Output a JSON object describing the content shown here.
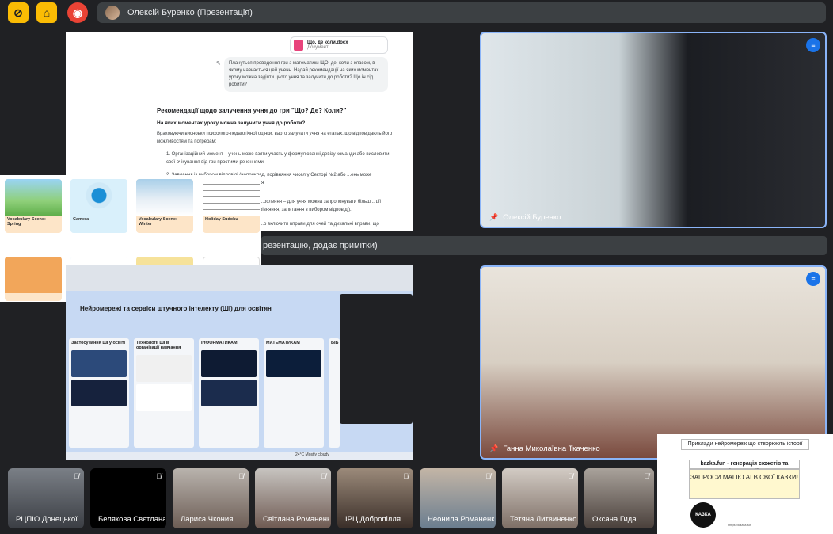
{
  "meeting": {
    "title": "Олексій Буренко (Презентація)",
    "caption": "резентацію, додає примітки)"
  },
  "colors": {
    "accent": "#8ab4f8",
    "speaking": "#1a73e8",
    "warning": "#fbbc04",
    "record": "#ea4335"
  },
  "toolbar": {
    "icons": [
      "no-captions-icon",
      "present-icon",
      "record-icon"
    ]
  },
  "doc": {
    "file_name": "Що, де коли.docx",
    "file_type": "Документ",
    "prompt": "Плануться проведення гри з математики ЩО, де, коли з класом, в якому навчається цей учень. Надай рекомендації на яких моментах уроку можна задіяти цього учня та залучити до роботи? Що ін сід робити?",
    "heading": "Рекомендації щодо залучення учня до гри \"Що? Де? Коли?\"",
    "subheading": "На яких моментах уроку можна залучити учня до роботи?",
    "p1": "Враховуючи висновки психолого-педагогічної оцінки, варто залучати учня на етапах, що відповідають його можливостям та потребам:",
    "p2a": "1. Організаційний момент – учень може взяти участь у формулюванні девізу команди або висловити свої очікування від гри простими реченнями.",
    "p2b": "2. Завдання із вибором відповіді (наприклад, порівняння чисел у Секторі №2 або ...ень може працювати із підтримкою асистента вчителя",
    "p3": "...ослення – для учня можна запропонувати більш ...ції рівняння, запитання з вибором відповіді).",
    "p4": "...о включити вправи для очей та дихальні вправи, що"
  },
  "apps": [
    {
      "label": "Vocabulary Scene: Spring"
    },
    {
      "label": "Camera"
    },
    {
      "label": "Vocabulary Scene: Winter"
    },
    {
      "label": "Holiday Sudoku"
    },
    {
      "label": ""
    },
    {
      "label": ""
    },
    {
      "label": ""
    },
    {
      "label": ""
    }
  ],
  "screen2": {
    "heading": "Нейромережі та сервіси штучного інтелекту (ШІ) для освітян",
    "columns": [
      "Застосування ШІ у освіті",
      "Технології ШІ в організації навчання",
      "ІНФОРМАТИКАМ",
      "МАТЕМАТИКАМ",
      "БІБ"
    ],
    "taskbar_weather": "24°C Mostly cloudy"
  },
  "speakers": [
    {
      "name": "Олексій Буренко"
    },
    {
      "name": "Ганна Миколаївна Ткаченко"
    }
  ],
  "participants": [
    {
      "name": "РЦПІО Донецької"
    },
    {
      "name": "Белякова Свєтлана"
    },
    {
      "name": "Лариса Чкония"
    },
    {
      "name": "Світлана Романенко"
    },
    {
      "name": "ІРЦ Добропілля"
    },
    {
      "name": "Неонила Романенко"
    },
    {
      "name": "Тетяна Литвиненко"
    },
    {
      "name": "Оксана Гида"
    }
  ],
  "kazka": {
    "title": "Приклади нейромереж що створюють історії",
    "site_line": "kazka.fun - генерація сюжетів та ілюстрацій",
    "cta": "ЗАПРОСИ МАГІЮ AI В СВОЇ КАЗКИ!",
    "logo": "КАЗКА",
    "url": "https://kazka.fun"
  }
}
